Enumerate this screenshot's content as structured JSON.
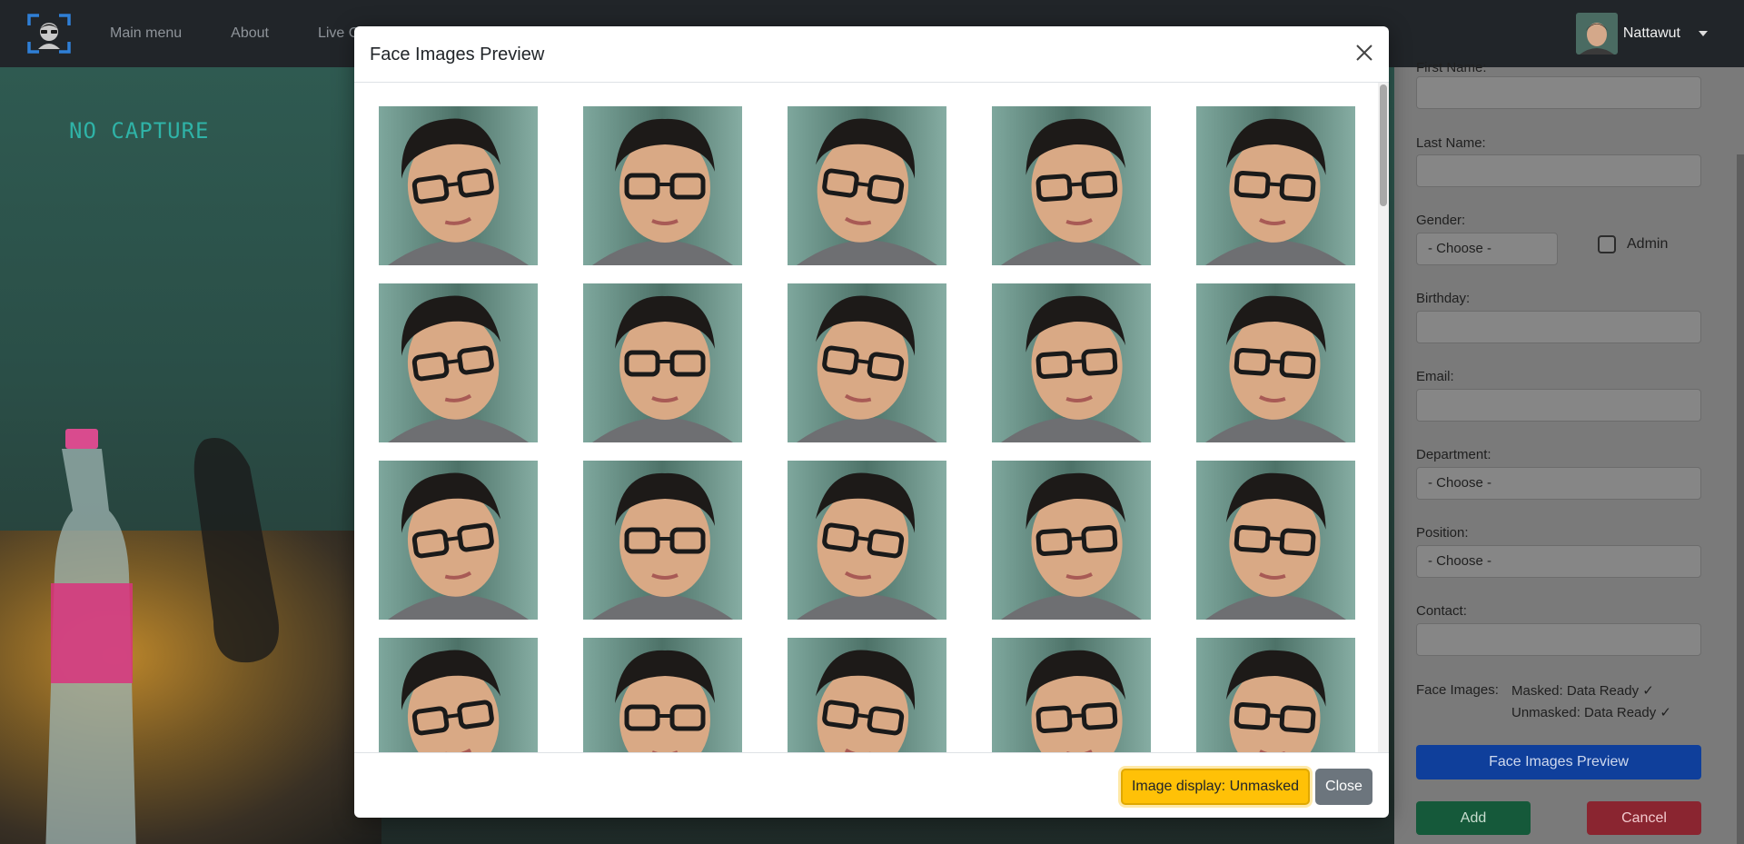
{
  "navbar": {
    "logo_icon": "face-scan-logo-icon",
    "links": [
      "Main menu",
      "About",
      "Live C"
    ],
    "user": {
      "name": "Nattawut",
      "avatar_icon": "user-avatar"
    }
  },
  "camera": {
    "status_text": "NO CAPTURE"
  },
  "form": {
    "first_name_label": "First Name:",
    "last_name_label": "Last Name:",
    "gender_label": "Gender:",
    "gender_value": "- Choose -",
    "admin_label": "Admin",
    "birthday_label": "Birthday:",
    "email_label": "Email:",
    "department_label": "Department:",
    "department_value": "- Choose -",
    "position_label": "Position:",
    "position_value": "- Choose -",
    "contact_label": "Contact:",
    "face_images_label": "Face Images:",
    "masked_status": "Masked: Data Ready ✓",
    "unmasked_status": "Unmasked: Data Ready ✓",
    "preview_button": "Face Images Preview",
    "add_button": "Add",
    "cancel_button": "Cancel"
  },
  "modal": {
    "title": "Face Images Preview",
    "close_icon": "close-icon",
    "display_button": "Image display: Unmasked",
    "close_button": "Close",
    "image_count_visible": 20
  },
  "colors": {
    "navbar": "#212529",
    "primary": "#0d6efd",
    "warning": "#ffc107",
    "secondary": "#6c757d",
    "success": "#198754",
    "danger": "#dc3545",
    "no_capture_text": "#2fb3a7"
  }
}
